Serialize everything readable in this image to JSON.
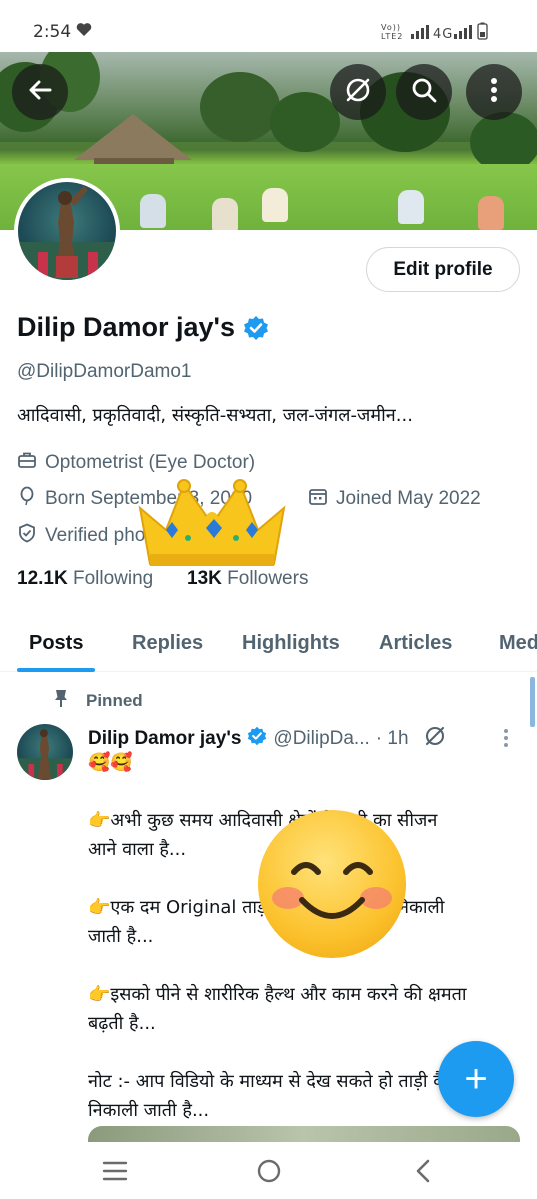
{
  "status_bar": {
    "time": "2:54",
    "right": "Vo)) LTE2 .ıl 4G .ıl"
  },
  "header": {
    "back_icon": "arrow-left-icon",
    "grok_icon": "slash-circle-icon",
    "search_icon": "search-icon",
    "more_icon": "more-vertical-icon"
  },
  "profile": {
    "edit_label": "Edit profile",
    "name": "Dilip Damor jay's",
    "handle": "@DilipDamorDamo1",
    "bio": "आदिवासी, प्रकृतिवादी, संस्कृति-सभ्यता, जल-जंगल-जमीन...",
    "profession": "Optometrist (Eye Doctor)",
    "born": "Born September 3, 2000",
    "joined": "Joined May 2022",
    "verified": "Verified phone",
    "following_count": "12.1K",
    "following_label": "Following",
    "followers_count": "13K",
    "followers_label": "Followers"
  },
  "tabs": [
    "Posts",
    "Replies",
    "Highlights",
    "Articles",
    "Media"
  ],
  "post": {
    "pinned_label": "Pinned",
    "name": "Dilip Damor jay's",
    "handle": "@DilipDa...",
    "time": "· 1h",
    "lines": [
      "🥰🥰",
      "",
      "👉अभी कुछ समय आदिवासी क्षेत्रों में ताड़ी का सीजन",
      "आने वाला है...",
      "",
      "👉एक दम Original ताड़ी होती है जो पेड़ से निकाली",
      "जाती है...",
      "",
      "👉इसको पीने से शारीरिक हैल्थ और काम करने की क्षमता",
      "बढ़ती है...",
      "",
      "नोट :- आप विडियो के माध्यम से देख सकते हो ताड़ी कैसे",
      "निकाली जाती है..."
    ]
  },
  "fab_label": "+",
  "colors": {
    "accent": "#1d9bf0",
    "text": "#0f1419",
    "secondary": "#536471"
  }
}
